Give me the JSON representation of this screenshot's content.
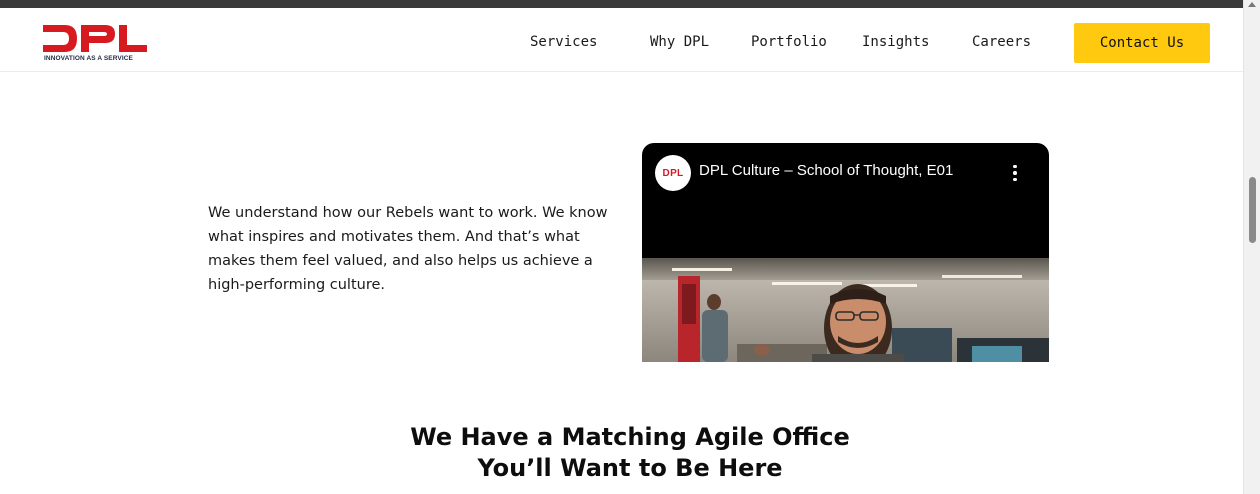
{
  "brand": {
    "logo_text": "DPL",
    "tagline": "INNOVATION AS A SERVICE",
    "accent_color": "#d71920"
  },
  "nav": {
    "items": [
      {
        "label": "Services"
      },
      {
        "label": "Why DPL"
      },
      {
        "label": "Portfolio"
      },
      {
        "label": "Insights"
      },
      {
        "label": "Careers"
      }
    ],
    "cta_label": "Contact Us",
    "cta_color": "#ffc90f"
  },
  "intro": {
    "text": "We understand how our Rebels want to work. We know what inspires and motivates them. And that’s what makes them feel valued, and also helps us achieve a high-performing culture."
  },
  "video": {
    "channel_avatar_text": "DPL",
    "title": "DPL Culture – School of Thought, E01",
    "menu_icon": "more-vertical-icon"
  },
  "section": {
    "heading_line1": "We Have a Matching Agile Office",
    "heading_line2": "You’ll Want to Be Here"
  }
}
